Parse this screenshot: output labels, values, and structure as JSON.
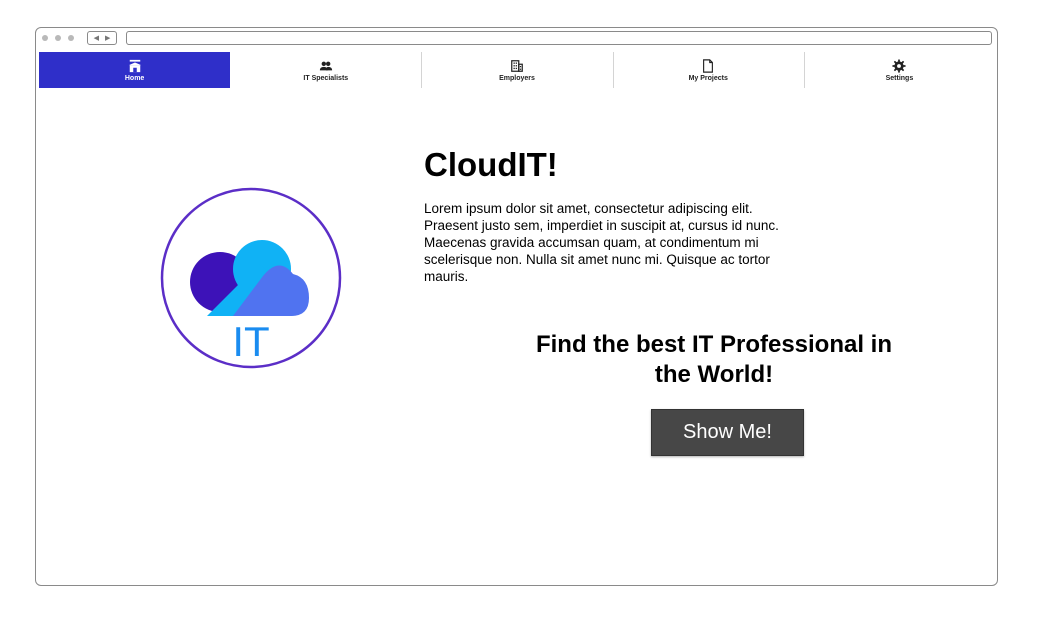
{
  "nav": {
    "items": [
      {
        "label": "Home",
        "icon": "home-icon",
        "active": true
      },
      {
        "label": "IT Specialists",
        "icon": "people-icon",
        "active": false
      },
      {
        "label": "Employers",
        "icon": "building-icon",
        "active": false
      },
      {
        "label": "My Projects",
        "icon": "document-icon",
        "active": false
      },
      {
        "label": "Settings",
        "icon": "gear-icon",
        "active": false
      }
    ]
  },
  "hero": {
    "title": "CloudIT!",
    "description": "Lorem ipsum dolor sit amet, consectetur adipiscing elit. Praesent justo sem, imperdiet in suscipit at, cursus id nunc. Maecenas gravida accumsan quam, at condimentum mi scelerisque non. Nulla sit amet nunc mi. Quisque ac tortor mauris.",
    "headline": "Find the best IT Professional in the World!",
    "cta_label": "Show Me!"
  },
  "logo": {
    "text": "IT"
  },
  "colors": {
    "accent": "#2f2fc9",
    "button": "#474747",
    "logo_ring": "#5b2ec7",
    "logo_cloud_light": "#10b2f5",
    "logo_cloud_blue": "#5073f0",
    "logo_cloud_dark": "#3d12b8"
  }
}
